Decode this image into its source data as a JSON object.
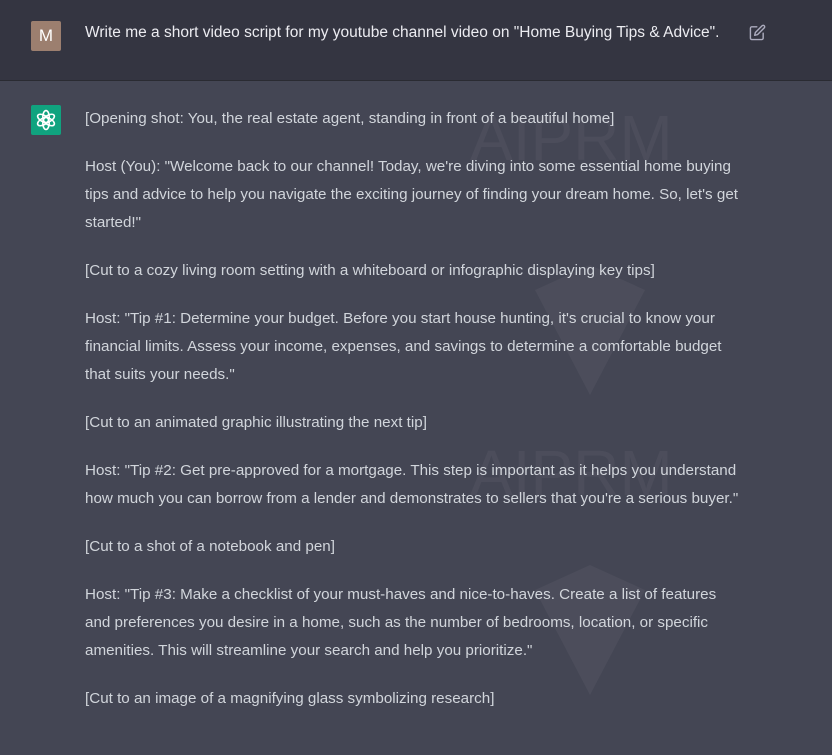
{
  "user": {
    "avatar_letter": "M",
    "prompt": "Write me a short video script for my youtube channel video on \"Home Buying Tips & Advice\"."
  },
  "assistant": {
    "paragraphs": [
      "[Opening shot: You, the real estate agent, standing in front of a beautiful home]",
      "Host (You): \"Welcome back to our channel! Today, we're diving into some essential home buying tips and advice to help you navigate the exciting journey of finding your dream home. So, let's get started!\"",
      "[Cut to a cozy living room setting with a whiteboard or infographic displaying key tips]",
      "Host: \"Tip #1: Determine your budget. Before you start house hunting, it's crucial to know your financial limits. Assess your income, expenses, and savings to determine a comfortable budget that suits your needs.\"",
      "[Cut to an animated graphic illustrating the next tip]",
      "Host: \"Tip #2: Get pre-approved for a mortgage. This step is important as it helps you understand how much you can borrow from a lender and demonstrates to sellers that you're a serious buyer.\"",
      "[Cut to a shot of a notebook and pen]",
      "Host: \"Tip #3: Make a checklist of your must-haves and nice-to-haves. Create a list of features and preferences you desire in a home, such as the number of bedrooms, location, or specific amenities. This will streamline your search and help you prioritize.\"",
      "[Cut to an image of a magnifying glass symbolizing research]"
    ]
  },
  "watermark": {
    "text_1": "AIPRM",
    "text_2": "AIPRM"
  },
  "colors": {
    "user_bg": "#343541",
    "assistant_bg": "#444654",
    "gpt_avatar": "#10a37f",
    "user_avatar": "#9c7f6f",
    "text": "#d1d5db"
  },
  "icons": {
    "edit": "edit-icon",
    "assistant_avatar": "openai-logo-icon"
  }
}
